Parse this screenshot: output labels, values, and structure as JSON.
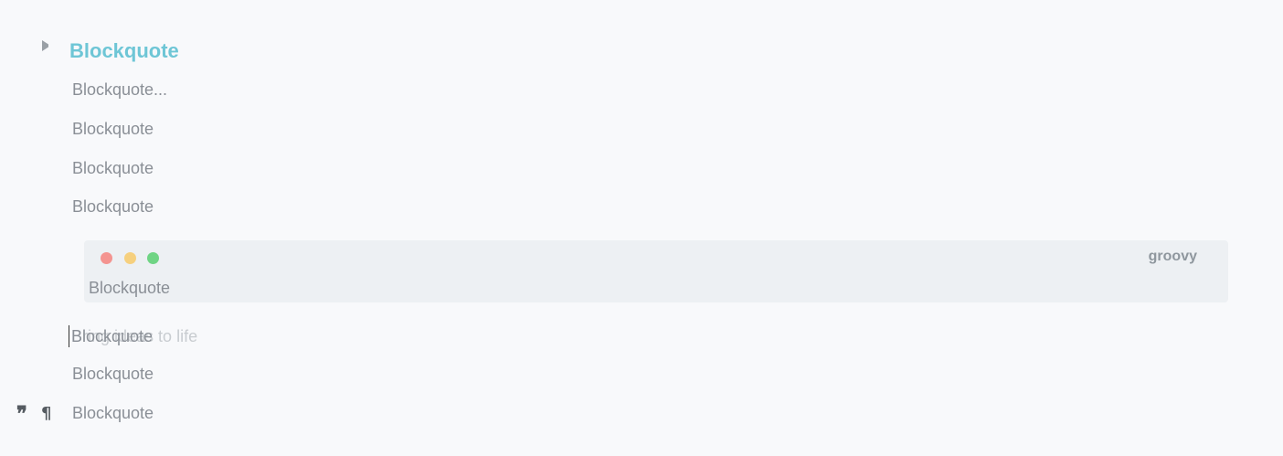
{
  "heading": {
    "toggle_icon": "triangle-right-icon",
    "text": "Blockquote"
  },
  "lines_before": [
    "Blockquote...",
    "Blockquote",
    "Blockquote",
    "Blockquote"
  ],
  "code_block": {
    "language": "groovy",
    "window_dots": [
      "#f49490",
      "#f6d07e",
      "#6fd484"
    ],
    "content": "Blockquote"
  },
  "active_line": {
    "value": "Blockquote",
    "placeholder": "Bring ideas to life"
  },
  "lines_after": [
    "Blockquote",
    "Blockquote"
  ],
  "block_tools": {
    "quote_icon": "quote-icon",
    "paragraph_icon": "pilcrow-icon"
  },
  "colors": {
    "accent": "#6ec6d6",
    "text": "#8a8f96",
    "background": "#f8f9fb",
    "code_background": "#edf0f3"
  }
}
